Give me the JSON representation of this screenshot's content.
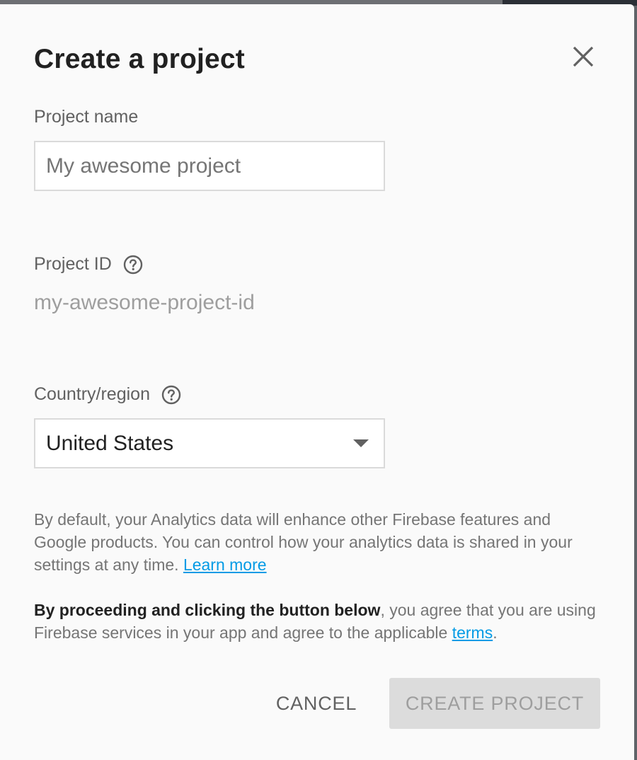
{
  "dialog": {
    "title": "Create a project",
    "close_icon": "close-icon"
  },
  "project_name": {
    "label": "Project name",
    "value": "",
    "placeholder": "My awesome project"
  },
  "project_id": {
    "label": "Project ID",
    "help_icon": "help-circle-icon",
    "value": "my-awesome-project-id"
  },
  "country": {
    "label": "Country/region",
    "help_icon": "help-circle-icon",
    "selected": "United States",
    "dropdown_icon": "caret-down-icon"
  },
  "analytics_notice": {
    "text": "By default, your Analytics data will enhance other Firebase features and Google products. You can control how your analytics data is shared in your settings at any time.",
    "link_label": "Learn more"
  },
  "terms_notice": {
    "bold_text": "By proceeding and clicking the button below",
    "text": ", you agree that you are using Firebase services in your app and agree to the applicable",
    "link_label": "terms",
    "trailing": "."
  },
  "actions": {
    "cancel_label": "CANCEL",
    "create_label": "CREATE PROJECT",
    "create_enabled": false
  },
  "colors": {
    "link": "#039be5",
    "dialog_background": "#fafafa",
    "disabled_button": "#dcdcdc"
  }
}
